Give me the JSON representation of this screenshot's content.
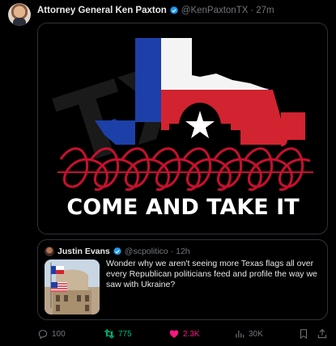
{
  "tweet": {
    "author_name": "Attorney General Ken Paxton",
    "handle": "@KenPaxtonTX",
    "separator": "·",
    "time": "27m",
    "image_text": {
      "watermark": "TX",
      "slogan": "COME AND TAKE IT"
    }
  },
  "quote": {
    "author_name": "Justin Evans",
    "handle": "@scpolitico",
    "separator": "·",
    "time": "12h",
    "text": "Wonder why we aren't seeing more Texas flags all over every Republican politicians feed and profile the way we saw with Ukraine?"
  },
  "actions": {
    "replies": "100",
    "retweets": "775",
    "likes": "2.3K",
    "views": "30K"
  },
  "colors": {
    "background": "#000000",
    "text": "#e7e9ea",
    "muted": "#71767b",
    "verified": "#1d9bf0",
    "retweet": "#00ba7c",
    "like": "#f91880",
    "flag_blue": "#1d3fa8",
    "flag_red": "#d22330",
    "wire_red": "#c8102e"
  },
  "icons": [
    "verified-badge-icon",
    "reply-icon",
    "retweet-icon",
    "like-icon",
    "views-icon",
    "bookmark-icon",
    "share-icon"
  ]
}
